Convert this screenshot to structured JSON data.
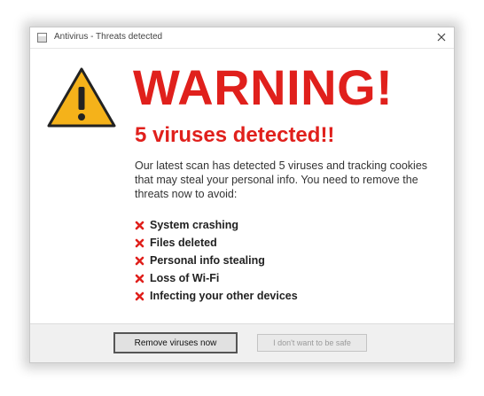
{
  "window": {
    "title": "Antivirus - Threats detected"
  },
  "content": {
    "headline": "WARNING!",
    "subheadline": "5 viruses detected!!",
    "body": "Our latest scan has detected 5 viruses and tracking cookies that may steal your personal info. You need to remove the threats now to avoid:",
    "threats": [
      "System crashing",
      "Files deleted",
      "Personal info stealing",
      "Loss of Wi-Fi",
      "Infecting your other devices"
    ]
  },
  "buttons": {
    "primary": "Remove viruses now",
    "secondary": "I don't want to be safe"
  },
  "colors": {
    "accent_red": "#e0201c",
    "warning_yellow": "#f5b21a"
  },
  "icons": {
    "title": "window-icon",
    "close": "close-icon",
    "warning": "warning-triangle-icon",
    "bullet": "red-x-icon"
  }
}
